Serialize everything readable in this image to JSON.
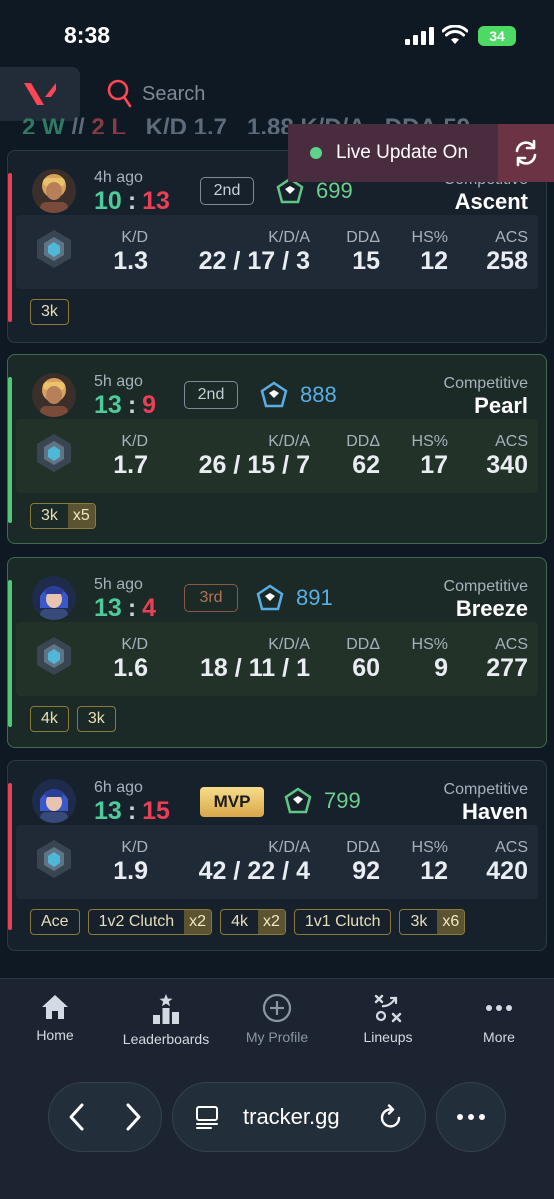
{
  "status": {
    "time": "8:38",
    "battery": "34"
  },
  "search": {
    "placeholder": "Search"
  },
  "summary": {
    "wins": "2 W",
    "sep": " // ",
    "losses": "2 L",
    "rest": "   K/D 1.7   1.88 K/D/A   DDΔ 59"
  },
  "live": {
    "label": "Live Update On",
    "status_color": "#5ed38a"
  },
  "stat_headers": {
    "kd": "K/D",
    "kda": "K/D/A",
    "dd": "DDΔ",
    "hs": "HS%",
    "acs": "ACS"
  },
  "matches": [
    {
      "result": "loss",
      "time_ago": "4h ago",
      "score_us": "10",
      "score_them": "13",
      "badge": "2nd",
      "rr": "699",
      "rr_color": "green",
      "mode": "Competitive",
      "map": "Ascent",
      "kd": "1.3",
      "kills": "22",
      "deaths": "17",
      "assists": "3",
      "dd": "15",
      "hs": "12",
      "acs": "258",
      "tags": [
        {
          "label": "3k",
          "mult": ""
        }
      ]
    },
    {
      "result": "win",
      "time_ago": "5h ago",
      "score_us": "13",
      "score_them": "9",
      "badge": "2nd",
      "rr": "888",
      "rr_color": "blue",
      "mode": "Competitive",
      "map": "Pearl",
      "kd": "1.7",
      "kills": "26",
      "deaths": "15",
      "assists": "7",
      "dd": "62",
      "hs": "17",
      "acs": "340",
      "tags": [
        {
          "label": "3k",
          "mult": "x5"
        }
      ]
    },
    {
      "result": "win",
      "time_ago": "5h ago",
      "score_us": "13",
      "score_them": "4",
      "badge": "3rd",
      "rr": "891",
      "rr_color": "blue",
      "mode": "Competitive",
      "map": "Breeze",
      "kd": "1.6",
      "kills": "18",
      "deaths": "11",
      "assists": "1",
      "dd": "60",
      "hs": "9",
      "acs": "277",
      "tags": [
        {
          "label": "4k",
          "mult": ""
        },
        {
          "label": "3k",
          "mult": ""
        }
      ]
    },
    {
      "result": "loss",
      "time_ago": "6h ago",
      "score_us": "13",
      "score_them": "15",
      "badge": "MVP",
      "rr": "799",
      "rr_color": "green",
      "mode": "Competitive",
      "map": "Haven",
      "kd": "1.9",
      "kills": "42",
      "deaths": "22",
      "assists": "4",
      "dd": "92",
      "hs": "12",
      "acs": "420",
      "tags": [
        {
          "label": "Ace",
          "mult": ""
        },
        {
          "label": "1v2 Clutch",
          "mult": "x2"
        },
        {
          "label": "4k",
          "mult": "x2"
        },
        {
          "label": "1v1 Clutch",
          "mult": ""
        },
        {
          "label": "3k",
          "mult": "x6"
        }
      ]
    }
  ],
  "tabs": [
    {
      "label": "Home",
      "icon": "home-icon"
    },
    {
      "label": "Leaderboards",
      "icon": "leaderboard-icon"
    },
    {
      "label": "My Profile",
      "icon": "add-circle-icon"
    },
    {
      "label": "Lineups",
      "icon": "lineups-icon"
    },
    {
      "label": "More",
      "icon": "more-icon"
    }
  ],
  "browser": {
    "url": "tracker.gg"
  },
  "colors": {
    "accent_red": "#e84057",
    "accent_green": "#4ecb72",
    "bg": "#0f1923"
  }
}
